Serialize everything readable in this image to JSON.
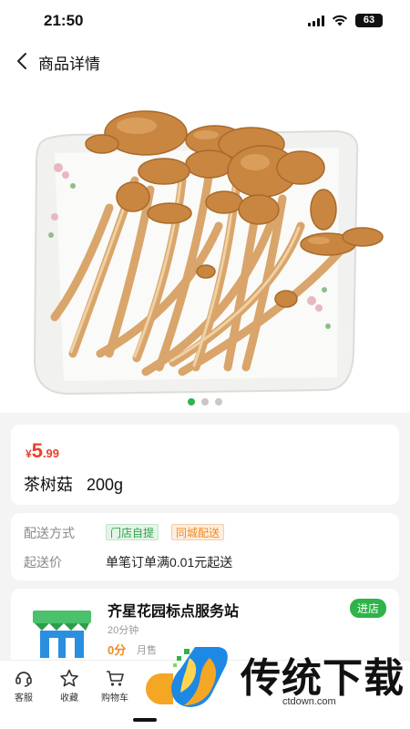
{
  "status_bar": {
    "time": "21:50",
    "battery": "63"
  },
  "nav": {
    "title": "商品详情"
  },
  "gallery": {
    "image_count": 3,
    "active_index": 0
  },
  "product": {
    "currency": "¥",
    "price_integer": "5",
    "price_decimal": ".99",
    "name": "茶树菇   200g"
  },
  "delivery": {
    "method_label": "配送方式",
    "tags": [
      "门店自提",
      "同城配送"
    ],
    "min_label": "起送价",
    "min_value": "单笔订单满0.01元起送"
  },
  "store": {
    "name": "齐星花园标点服务站",
    "enter_label": "进店",
    "meta": "20分钟",
    "fee": "0分",
    "monthly_label": "月售"
  },
  "bottom_bar": {
    "service": "客服",
    "favorite": "收藏",
    "cart": "购物车"
  },
  "watermark": {
    "title": "传统下载",
    "url": "ctdown.com"
  },
  "colors": {
    "accent": "#2fb34a",
    "price": "#e8412d",
    "orange": "#f08a24"
  }
}
